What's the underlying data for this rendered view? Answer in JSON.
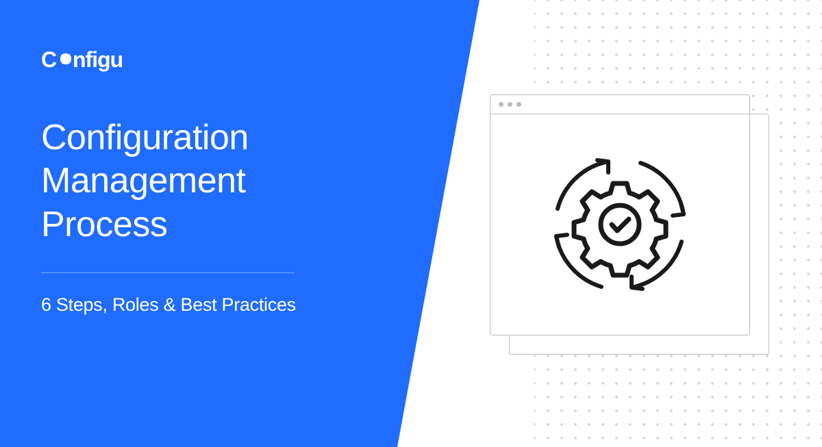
{
  "brand": {
    "logo_text": "Configu"
  },
  "hero": {
    "title_line1": "Configuration",
    "title_line2": "Management",
    "title_line3": "Process",
    "subtitle": "6 Steps, Roles & Best Practices"
  },
  "colors": {
    "primary": "#1f6cff",
    "background": "#ffffff",
    "dot": "#d0d4d9",
    "border": "#b8bcc1",
    "icon": "#1a1a1a"
  },
  "icons": {
    "main": "gear-check-cycle-icon",
    "window_controls": [
      "dot",
      "dot",
      "dot"
    ]
  }
}
